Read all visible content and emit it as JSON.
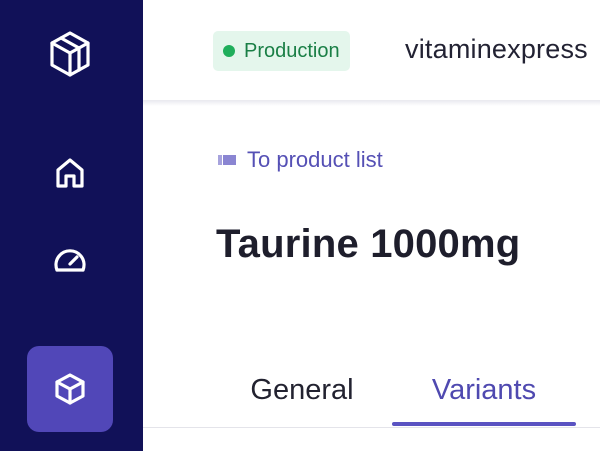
{
  "colors": {
    "sidebar_bg": "#111158",
    "active_nav_bg": "#5147b8",
    "accent": "#5550b5",
    "env_badge_bg": "#e4f6ec",
    "env_badge_text": "#1a7f46",
    "env_dot": "#1fae5b"
  },
  "sidebar": {
    "logo_icon": "cube-outline-logo-icon",
    "items": [
      {
        "id": "home",
        "icon": "home-icon",
        "active": false
      },
      {
        "id": "dashboard",
        "icon": "speedometer-icon",
        "active": false
      },
      {
        "id": "products",
        "icon": "cube-icon",
        "active": true
      }
    ]
  },
  "header": {
    "environment": "Production",
    "shop_name": "vitaminexpress"
  },
  "page": {
    "back_link": "To product list",
    "back_icon": "back-arrow-icon",
    "title": "Taurine 1000mg"
  },
  "tabs": [
    {
      "label": "General",
      "active": false
    },
    {
      "label": "Variants",
      "active": true
    }
  ]
}
